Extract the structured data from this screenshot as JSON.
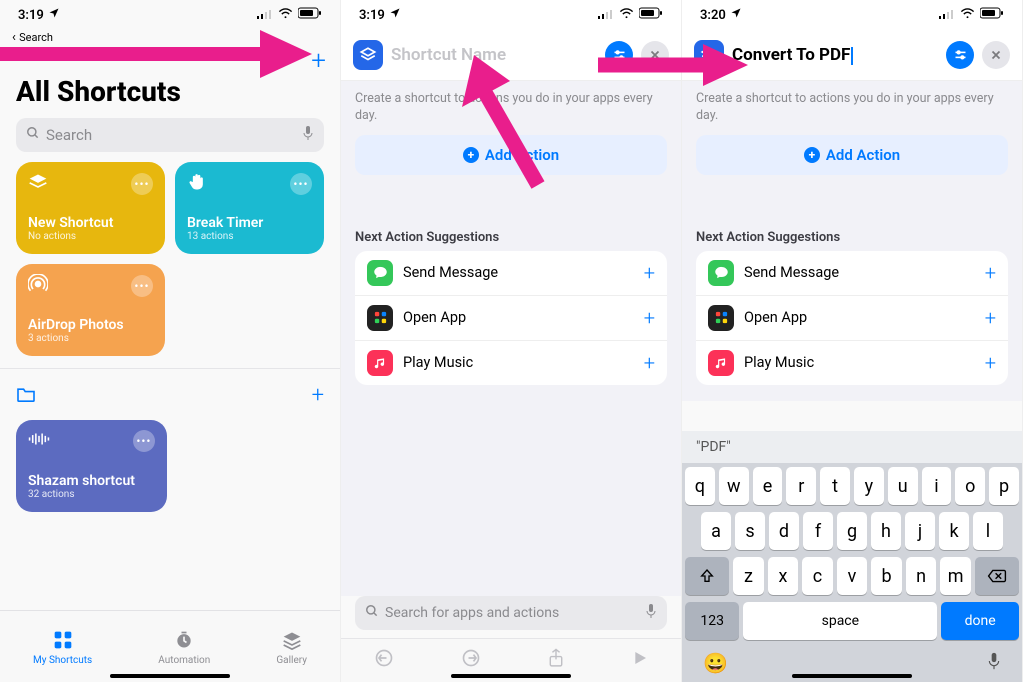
{
  "status": {
    "time_a": "3:19",
    "time_b": "3:19",
    "time_c": "3:20"
  },
  "screen1": {
    "back": "Search",
    "title": "All Shortcuts",
    "search_placeholder": "Search",
    "cards": [
      {
        "title": "New Shortcut",
        "sub": "No actions",
        "color": "yellow",
        "icon": "layers"
      },
      {
        "title": "Break Timer",
        "sub": "13 actions",
        "color": "teal",
        "icon": "hand"
      },
      {
        "title": "AirDrop Photos",
        "sub": "3 actions",
        "color": "orange",
        "icon": "airdrop"
      },
      {
        "title": "Shazam shortcut",
        "sub": "32 actions",
        "color": "purple",
        "icon": "wave"
      }
    ],
    "tabs": [
      {
        "label": "My Shortcuts",
        "active": true
      },
      {
        "label": "Automation",
        "active": false
      },
      {
        "label": "Gallery",
        "active": false
      }
    ]
  },
  "editor": {
    "placeholder_name": "Shortcut Name",
    "typed_name": "Convert To PDF",
    "hint": "Create a shortcut to actions you do in your apps every day.",
    "add_action": "Add Action",
    "suggestions_label": "Next Action Suggestions",
    "suggestions": [
      {
        "label": "Send Message",
        "color": "#34c759",
        "glyph": "msg"
      },
      {
        "label": "Open App",
        "color": "linear",
        "glyph": "grid"
      },
      {
        "label": "Play Music",
        "color": "#fc3158",
        "glyph": "music"
      }
    ],
    "bottom_search": "Search for apps and actions"
  },
  "keyboard": {
    "suggestion": "\"PDF\"",
    "row1": [
      "q",
      "w",
      "e",
      "r",
      "t",
      "y",
      "u",
      "i",
      "o",
      "p"
    ],
    "row2": [
      "a",
      "s",
      "d",
      "f",
      "g",
      "h",
      "j",
      "k",
      "l"
    ],
    "row3": [
      "z",
      "x",
      "c",
      "v",
      "b",
      "n",
      "m"
    ],
    "numkey": "123",
    "space": "space",
    "done": "done"
  }
}
